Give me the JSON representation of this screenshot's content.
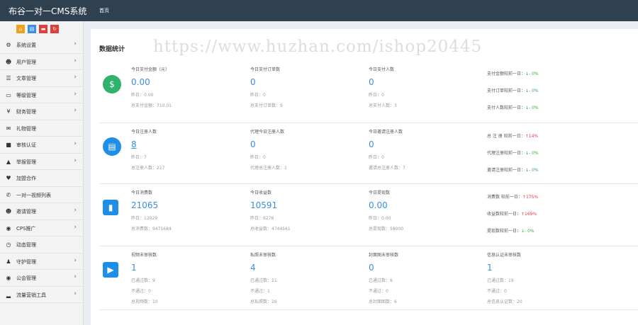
{
  "header": {
    "brand": "布谷一对一CMS系统",
    "nav_home": "首页"
  },
  "quick_buttons": [
    {
      "icon": "home-icon",
      "color": "#f0a01d",
      "glyph": "⌂"
    },
    {
      "icon": "document-icon",
      "color": "#3a8ee6",
      "glyph": "▤"
    },
    {
      "icon": "trash-icon",
      "color": "#e23d3d",
      "glyph": "▬"
    },
    {
      "icon": "refresh-icon",
      "color": "#e23d3d",
      "glyph": "↻"
    }
  ],
  "sidebar": {
    "items": [
      {
        "label": "系统设置",
        "icon": "gears-icon",
        "glyph": "⚙",
        "arrow": "›"
      },
      {
        "label": "用户管理",
        "icon": "users-icon",
        "glyph": "☻",
        "arrow": "›"
      },
      {
        "label": "文章管理",
        "icon": "list-icon",
        "glyph": "☰",
        "arrow": "›"
      },
      {
        "label": "等级管理",
        "icon": "monitor-icon",
        "glyph": "▭",
        "arrow": "›"
      },
      {
        "label": "财务管理",
        "icon": "yen-icon",
        "glyph": "¥",
        "arrow": "›"
      },
      {
        "label": "礼物管理",
        "icon": "gift-icon",
        "glyph": "✉",
        "arrow": ""
      },
      {
        "label": "审核认证",
        "icon": "video-icon",
        "glyph": "■",
        "arrow": "›"
      },
      {
        "label": "举报管理",
        "icon": "warning-icon",
        "glyph": "▲",
        "arrow": "›"
      },
      {
        "label": "加盟合作",
        "icon": "heart-icon",
        "glyph": "♥",
        "arrow": ""
      },
      {
        "label": "一对一视频列表",
        "icon": "phone-icon",
        "glyph": "✆",
        "arrow": ""
      },
      {
        "label": "邀请管理",
        "icon": "group-icon",
        "glyph": "☻",
        "arrow": "›"
      },
      {
        "label": "CPS推广",
        "icon": "eye-icon",
        "glyph": "◉",
        "arrow": "›"
      },
      {
        "label": "动态管理",
        "icon": "clock-icon",
        "glyph": "◷",
        "arrow": ""
      },
      {
        "label": "守护管理",
        "icon": "user-shield-icon",
        "glyph": "♟",
        "arrow": "›"
      },
      {
        "label": "公会管理",
        "icon": "eye-icon",
        "glyph": "◉",
        "arrow": "›"
      },
      {
        "label": "流量营销工具",
        "icon": "signal-icon",
        "glyph": "▂",
        "arrow": "›"
      }
    ]
  },
  "panel": {
    "title": "数据统计",
    "watermark": "https://www.huzhan.com/ishop20445"
  },
  "rows": [
    {
      "badge_color": "#2eb26c",
      "badge_glyph": "$",
      "badge_icon": "money-user-icon",
      "square": false,
      "cols": [
        {
          "title": "今日支付金额（元）",
          "value": "0.00",
          "sub1": "昨日：0.00",
          "sub2": "总支付金额：710.01"
        },
        {
          "title": "今日支付订单数",
          "value": "0",
          "sub1": "昨日：0",
          "sub2": "总支付订单数：9"
        },
        {
          "title": "今日支付人数",
          "value": "0",
          "sub1": "昨日：0",
          "sub2": "总支付人数：3"
        }
      ],
      "compare": [
        {
          "label": "支付金额较前一日：",
          "arrow": "↓",
          "value": "- 0%",
          "dir": "down"
        },
        {
          "label": "支付订单较前一日：",
          "arrow": "↓",
          "value": "- 0%",
          "dir": "down"
        },
        {
          "label": "支付人数较前一日：",
          "arrow": "↓",
          "value": "- 0%",
          "dir": "down"
        }
      ]
    },
    {
      "badge_color": "#1e8ee8",
      "badge_glyph": "▤",
      "badge_icon": "clipboard-icon",
      "square": false,
      "cols": [
        {
          "title": "今日注册人数",
          "value": "8",
          "sub1": "昨日：7",
          "sub2": "总注册人数：217",
          "link": true
        },
        {
          "title": "代理今日注册人数",
          "value": "0",
          "sub1": "昨日：0",
          "sub2": "代理总注册人数：1"
        },
        {
          "title": "今日邀请注册人数",
          "value": "0",
          "sub1": "昨日：0",
          "sub2": "邀请总注册人数：7"
        }
      ],
      "compare": [
        {
          "label": "总 注 册 较前一日：",
          "arrow": "↑",
          "value": "14%",
          "dir": "up"
        },
        {
          "label": "代理注册较前一日：",
          "arrow": "↓",
          "value": "- 0%",
          "dir": "down"
        },
        {
          "label": "邀请注册较前一日：",
          "arrow": "↓",
          "value": "- 0%",
          "dir": "down"
        }
      ]
    },
    {
      "badge_color": "#1e8ee8",
      "badge_glyph": "▮",
      "badge_icon": "book-icon",
      "square": true,
      "cols": [
        {
          "title": "今日消费数",
          "value": "21065",
          "sub1": "昨日：12029",
          "sub2": "总消费数：9471684"
        },
        {
          "title": "今日收益数",
          "value": "10591",
          "sub1": "昨日：6276",
          "sub2": "总收益数：4744561"
        },
        {
          "title": "今日提现数",
          "value": "0.00",
          "sub1": "昨日：0.00",
          "sub2": "总提现数：58000"
        }
      ],
      "compare": [
        {
          "label": "消费数 较前一日：",
          "arrow": "↑",
          "value": "175%",
          "dir": "up"
        },
        {
          "label": "收益数较前一日：",
          "arrow": "↑",
          "value": "169%",
          "dir": "up"
        },
        {
          "label": "提现数较前一日：",
          "arrow": "↓",
          "value": "- 0%",
          "dir": "down"
        }
      ]
    },
    {
      "badge_color": "#1e8ee8",
      "badge_glyph": "▶",
      "badge_icon": "tv-icon",
      "square": true,
      "cols": [
        {
          "title": "视频未审核数",
          "value": "1",
          "sub1": "已通过数：9",
          "sub2": "不通过：0",
          "sub3": "总视频数：10"
        },
        {
          "title": "私照未审核数",
          "value": "4",
          "sub1": "已通过数：21",
          "sub2": "不通过：1",
          "sub3": "总私照数：26"
        },
        {
          "title": "封面图未审核数",
          "value": "0",
          "sub1": "已通过数：6",
          "sub2": "不通过：0",
          "sub3": "总封面图数：6"
        },
        {
          "title": "信息认证未审核数",
          "value": "1",
          "sub1": "已通过数：19",
          "sub2": "不通过：0",
          "sub3": "总信息认证数：20"
        }
      ],
      "compare": []
    }
  ]
}
